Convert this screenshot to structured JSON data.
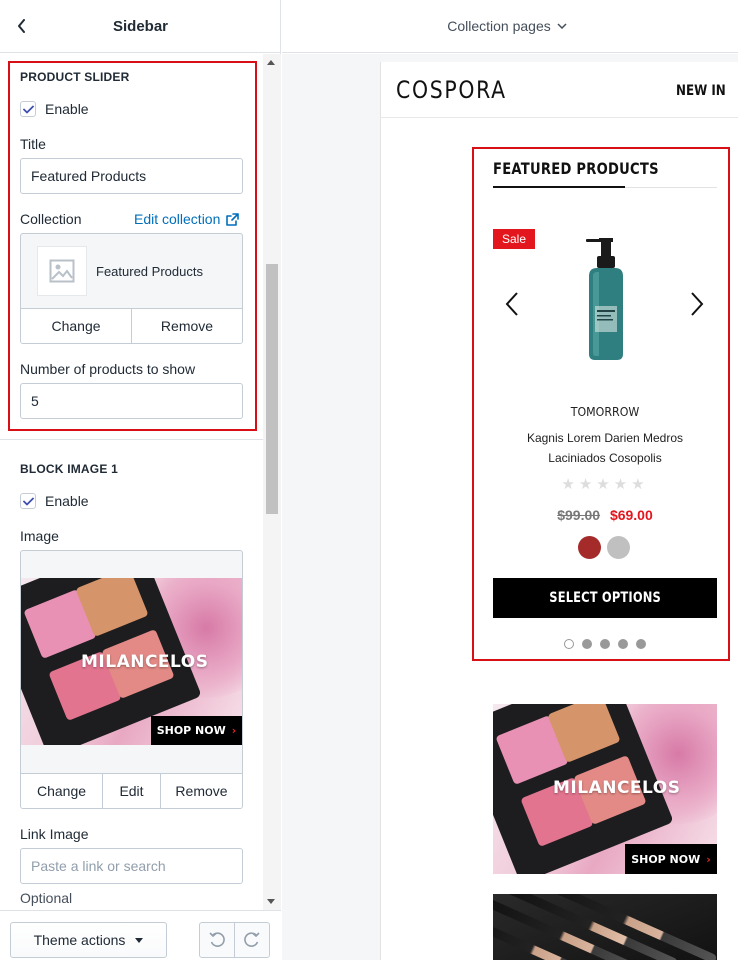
{
  "sidebar": {
    "title": "Sidebar",
    "product_slider": {
      "heading": "PRODUCT SLIDER",
      "enable_label": "Enable",
      "title_label": "Title",
      "title_value": "Featured Products",
      "collection_label": "Collection",
      "edit_collection": "Edit collection",
      "collection_name": "Featured Products",
      "change": "Change",
      "remove": "Remove",
      "count_label": "Number of products to show",
      "count_value": "5"
    },
    "block_image": {
      "heading": "BLOCK IMAGE 1",
      "enable_label": "Enable",
      "image_label": "Image",
      "change": "Change",
      "edit": "Edit",
      "remove": "Remove",
      "link_label": "Link Image",
      "link_placeholder": "Paste a link or search",
      "optional_label": "Optional"
    },
    "theme_actions": "Theme actions"
  },
  "image_banner": {
    "brand": "MILANCELOS",
    "shop_now": "SHOP NOW"
  },
  "preview": {
    "page_selector": "Collection pages",
    "logo": "COSPORA",
    "nav_new_in": "NEW IN",
    "featured_title": "FEATURED PRODUCTS",
    "sale_badge": "Sale",
    "product": {
      "vendor": "TOMORROW",
      "name_line1": "Kagnis Lorem Darien Medros",
      "name_line2": "Laciniados Cosopolis",
      "old_price": "$99.00",
      "new_price": "$69.00",
      "swatch_colors": [
        "#a52a2a",
        "#c0c0c0"
      ],
      "rating": 0
    },
    "select_options": "SELECT OPTIONS",
    "slider_dots": 5,
    "active_dot": 0
  },
  "colors": {
    "highlight_border": "#d80f16",
    "link": "#006fbb",
    "sale": "#e4161d",
    "checkbox_check": "#3f4eae"
  }
}
